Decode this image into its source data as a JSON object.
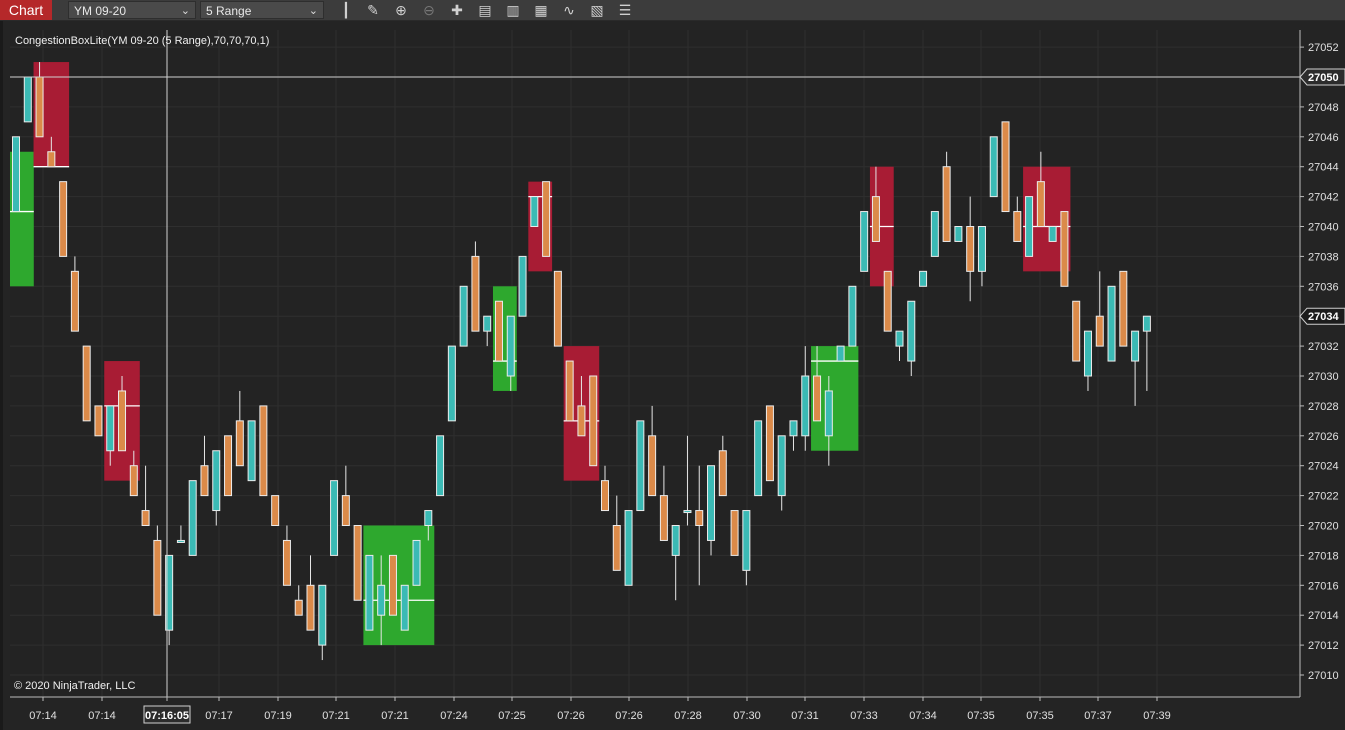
{
  "toolbar": {
    "tab_label": "Chart",
    "instrument": "YM 09-20",
    "period": "5 Range",
    "icons": [
      "bar-type-icon",
      "draw-pencil-icon",
      "zoom-in-icon",
      "zoom-out-icon",
      "crosshair-icon",
      "data-box-icon",
      "templates-icon",
      "strategies-icon",
      "indicators-icon",
      "properties-icon",
      "object-list-icon"
    ]
  },
  "chart_data": {
    "type": "candlestick",
    "title": "CongestionBoxLite(YM 09-20 (5 Range),70,70,70,1)",
    "copyright": "© 2020 NinjaTrader, LLC",
    "ylim": [
      27009,
      27053
    ],
    "yticks": [
      27010,
      27012,
      27014,
      27016,
      27018,
      27020,
      27022,
      27024,
      27026,
      27028,
      27030,
      27032,
      27034,
      27036,
      27038,
      27040,
      27042,
      27044,
      27046,
      27048,
      27050,
      27052
    ],
    "xticks": [
      "07:14",
      "07:14",
      "07:16:05",
      "07:17",
      "07:19",
      "07:21",
      "07:21",
      "07:24",
      "07:25",
      "07:26",
      "07:26",
      "07:28",
      "07:30",
      "07:31",
      "07:33",
      "07:34",
      "07:35",
      "07:35",
      "07:37",
      "07:39"
    ],
    "highlighted_xtick": "07:16:05",
    "crosshair_price": "27050",
    "last_price": "27034",
    "colors": {
      "background": "#232323",
      "up_body": "#3bbab5",
      "down_body": "#db8a49",
      "wick": "#e6e6e6",
      "box_up": "#2ea82e",
      "box_down": "#a81c34",
      "crosshair": "#d0d0d0",
      "grid": "#2f2f2f"
    },
    "candles": [
      {
        "o": 27041,
        "h": 27046,
        "l": 27041,
        "c": 27046
      },
      {
        "o": 27047,
        "h": 27050,
        "l": 27047,
        "c": 27050
      },
      {
        "o": 27050,
        "h": 27051,
        "l": 27046,
        "c": 27046
      },
      {
        "o": 27045,
        "h": 27046,
        "l": 27044,
        "c": 27044
      },
      {
        "o": 27043,
        "h": 27043,
        "l": 27038,
        "c": 27038
      },
      {
        "o": 27037,
        "h": 27038,
        "l": 27033,
        "c": 27033
      },
      {
        "o": 27032,
        "h": 27032,
        "l": 27027,
        "c": 27027
      },
      {
        "o": 27028,
        "h": 27028,
        "l": 27026,
        "c": 27026
      },
      {
        "o": 27025,
        "h": 27028,
        "l": 27024,
        "c": 27028
      },
      {
        "o": 27029,
        "h": 27030,
        "l": 27025,
        "c": 27025
      },
      {
        "o": 27024,
        "h": 27025,
        "l": 27022,
        "c": 27022
      },
      {
        "o": 27021,
        "h": 27024,
        "l": 27020,
        "c": 27020
      },
      {
        "o": 27019,
        "h": 27020,
        "l": 27014,
        "c": 27014
      },
      {
        "o": 27013,
        "h": 27018,
        "l": 27012,
        "c": 27018
      },
      {
        "o": 27019,
        "h": 27020,
        "l": 27019,
        "c": 27019
      },
      {
        "o": 27018,
        "h": 27023,
        "l": 27018,
        "c": 27023
      },
      {
        "o": 27024,
        "h": 27026,
        "l": 27022,
        "c": 27022
      },
      {
        "o": 27021,
        "h": 27025,
        "l": 27020,
        "c": 27025
      },
      {
        "o": 27026,
        "h": 27026,
        "l": 27022,
        "c": 27022
      },
      {
        "o": 27027,
        "h": 27029,
        "l": 27024,
        "c": 27024
      },
      {
        "o": 27023,
        "h": 27027,
        "l": 27023,
        "c": 27027
      },
      {
        "o": 27028,
        "h": 27028,
        "l": 27022,
        "c": 27022
      },
      {
        "o": 27022,
        "h": 27022,
        "l": 27020,
        "c": 27020
      },
      {
        "o": 27019,
        "h": 27020,
        "l": 27016,
        "c": 27016
      },
      {
        "o": 27015,
        "h": 27016,
        "l": 27014,
        "c": 27014
      },
      {
        "o": 27016,
        "h": 27018,
        "l": 27013,
        "c": 27013
      },
      {
        "o": 27012,
        "h": 27016,
        "l": 27011,
        "c": 27016
      },
      {
        "o": 27018,
        "h": 27023,
        "l": 27018,
        "c": 27023
      },
      {
        "o": 27022,
        "h": 27024,
        "l": 27020,
        "c": 27020
      },
      {
        "o": 27020,
        "h": 27020,
        "l": 27015,
        "c": 27015
      },
      {
        "o": 27013,
        "h": 27018,
        "l": 27013,
        "c": 27018
      },
      {
        "o": 27014,
        "h": 27018,
        "l": 27012,
        "c": 27016
      },
      {
        "o": 27018,
        "h": 27018,
        "l": 27014,
        "c": 27014
      },
      {
        "o": 27013,
        "h": 27016,
        "l": 27013,
        "c": 27016
      },
      {
        "o": 27016,
        "h": 27019,
        "l": 27016,
        "c": 27019
      },
      {
        "o": 27020,
        "h": 27021,
        "l": 27019,
        "c": 27021
      },
      {
        "o": 27022,
        "h": 27026,
        "l": 27022,
        "c": 27026
      },
      {
        "o": 27027,
        "h": 27032,
        "l": 27027,
        "c": 27032
      },
      {
        "o": 27032,
        "h": 27036,
        "l": 27032,
        "c": 27036
      },
      {
        "o": 27038,
        "h": 27039,
        "l": 27033,
        "c": 27033
      },
      {
        "o": 27033,
        "h": 27034,
        "l": 27032,
        "c": 27034
      },
      {
        "o": 27035,
        "h": 27035,
        "l": 27031,
        "c": 27031
      },
      {
        "o": 27030,
        "h": 27034,
        "l": 27029,
        "c": 27034
      },
      {
        "o": 27034,
        "h": 27038,
        "l": 27034,
        "c": 27038
      },
      {
        "o": 27040,
        "h": 27042,
        "l": 27040,
        "c": 27042
      },
      {
        "o": 27043,
        "h": 27043,
        "l": 27038,
        "c": 27038
      },
      {
        "o": 27037,
        "h": 27037,
        "l": 27032,
        "c": 27032
      },
      {
        "o": 27031,
        "h": 27031,
        "l": 27027,
        "c": 27027
      },
      {
        "o": 27028,
        "h": 27030,
        "l": 27026,
        "c": 27026
      },
      {
        "o": 27030,
        "h": 27030,
        "l": 27024,
        "c": 27024
      },
      {
        "o": 27023,
        "h": 27024,
        "l": 27021,
        "c": 27021
      },
      {
        "o": 27020,
        "h": 27022,
        "l": 27017,
        "c": 27017
      },
      {
        "o": 27016,
        "h": 27021,
        "l": 27016,
        "c": 27021
      },
      {
        "o": 27021,
        "h": 27027,
        "l": 27021,
        "c": 27027
      },
      {
        "o": 27026,
        "h": 27028,
        "l": 27022,
        "c": 27022
      },
      {
        "o": 27022,
        "h": 27024,
        "l": 27019,
        "c": 27019
      },
      {
        "o": 27018,
        "h": 27020,
        "l": 27015,
        "c": 27020
      },
      {
        "o": 27021,
        "h": 27026,
        "l": 27020,
        "c": 27021
      },
      {
        "o": 27021,
        "h": 27024,
        "l": 27016,
        "c": 27020
      },
      {
        "o": 27019,
        "h": 27024,
        "l": 27018,
        "c": 27024
      },
      {
        "o": 27025,
        "h": 27026,
        "l": 27022,
        "c": 27022
      },
      {
        "o": 27021,
        "h": 27021,
        "l": 27018,
        "c": 27018
      },
      {
        "o": 27017,
        "h": 27021,
        "l": 27016,
        "c": 27021
      },
      {
        "o": 27022,
        "h": 27027,
        "l": 27022,
        "c": 27027
      },
      {
        "o": 27028,
        "h": 27028,
        "l": 27023,
        "c": 27023
      },
      {
        "o": 27022,
        "h": 27026,
        "l": 27021,
        "c": 27026
      },
      {
        "o": 27026,
        "h": 27027,
        "l": 27025,
        "c": 27027
      },
      {
        "o": 27026,
        "h": 27032,
        "l": 27025,
        "c": 27030
      },
      {
        "o": 27030,
        "h": 27032,
        "l": 27027,
        "c": 27027
      },
      {
        "o": 27026,
        "h": 27030,
        "l": 27024,
        "c": 27029
      },
      {
        "o": 27031,
        "h": 27032,
        "l": 27031,
        "c": 27032
      },
      {
        "o": 27032,
        "h": 27036,
        "l": 27032,
        "c": 27036
      },
      {
        "o": 27037,
        "h": 27041,
        "l": 27037,
        "c": 27041
      },
      {
        "o": 27042,
        "h": 27044,
        "l": 27039,
        "c": 27039
      },
      {
        "o": 27037,
        "h": 27037,
        "l": 27033,
        "c": 27033
      },
      {
        "o": 27032,
        "h": 27033,
        "l": 27031,
        "c": 27033
      },
      {
        "o": 27031,
        "h": 27035,
        "l": 27030,
        "c": 27035
      },
      {
        "o": 27036,
        "h": 27037,
        "l": 27036,
        "c": 27037
      },
      {
        "o": 27038,
        "h": 27041,
        "l": 27038,
        "c": 27041
      },
      {
        "o": 27044,
        "h": 27045,
        "l": 27039,
        "c": 27039
      },
      {
        "o": 27039,
        "h": 27040,
        "l": 27039,
        "c": 27040
      },
      {
        "o": 27040,
        "h": 27042,
        "l": 27035,
        "c": 27037
      },
      {
        "o": 27037,
        "h": 27040,
        "l": 27036,
        "c": 27040
      },
      {
        "o": 27042,
        "h": 27046,
        "l": 27042,
        "c": 27046
      },
      {
        "o": 27047,
        "h": 27047,
        "l": 27041,
        "c": 27041
      },
      {
        "o": 27041,
        "h": 27042,
        "l": 27039,
        "c": 27039
      },
      {
        "o": 27038,
        "h": 27042,
        "l": 27038,
        "c": 27042
      },
      {
        "o": 27043,
        "h": 27045,
        "l": 27040,
        "c": 27040
      },
      {
        "o": 27039,
        "h": 27040,
        "l": 27039,
        "c": 27040
      },
      {
        "o": 27041,
        "h": 27041,
        "l": 27036,
        "c": 27036
      },
      {
        "o": 27035,
        "h": 27035,
        "l": 27031,
        "c": 27031
      },
      {
        "o": 27030,
        "h": 27033,
        "l": 27029,
        "c": 27033
      },
      {
        "o": 27034,
        "h": 27037,
        "l": 27032,
        "c": 27032
      },
      {
        "o": 27031,
        "h": 27036,
        "l": 27031,
        "c": 27036
      },
      {
        "o": 27037,
        "h": 27037,
        "l": 27032,
        "c": 27032
      },
      {
        "o": 27031,
        "h": 27031,
        "l": 27028,
        "c": 27033
      },
      {
        "o": 27033,
        "h": 27034,
        "l": 27029,
        "c": 27034
      }
    ],
    "boxes": [
      {
        "type": "up",
        "from": 0,
        "to": 1,
        "top": 27045,
        "bottom": 27036,
        "mid": 27041
      },
      {
        "type": "down",
        "from": 2,
        "to": 4,
        "top": 27051,
        "bottom": 27044,
        "mid": 27044
      },
      {
        "type": "down",
        "from": 8,
        "to": 10,
        "top": 27031,
        "bottom": 27023,
        "mid": 27028
      },
      {
        "type": "up",
        "from": 30,
        "to": 35,
        "top": 27020,
        "bottom": 27012,
        "mid": 27015
      },
      {
        "type": "up",
        "from": 41,
        "to": 42,
        "top": 27036,
        "bottom": 27029,
        "mid": 27031
      },
      {
        "type": "down",
        "from": 44,
        "to": 45,
        "top": 27043,
        "bottom": 27037,
        "mid": 27042
      },
      {
        "type": "down",
        "from": 47,
        "to": 49,
        "top": 27032,
        "bottom": 27023,
        "mid": 27027
      },
      {
        "type": "up",
        "from": 68,
        "to": 71,
        "top": 27032,
        "bottom": 27025,
        "mid": 27031
      },
      {
        "type": "down",
        "from": 73,
        "to": 74,
        "top": 27044,
        "bottom": 27036,
        "mid": 27040
      },
      {
        "type": "down",
        "from": 86,
        "to": 89,
        "top": 27044,
        "bottom": 27037,
        "mid": 27040
      }
    ]
  }
}
